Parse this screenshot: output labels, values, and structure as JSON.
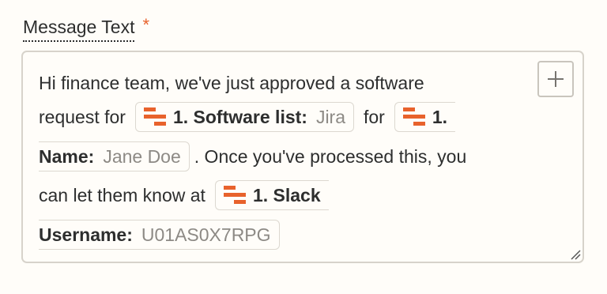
{
  "field": {
    "label": "Message Text",
    "required_mark": "*"
  },
  "message": {
    "line1": "Hi finance team, we've just approved a software",
    "request_for": "request for",
    "software_key": "1. Software list:",
    "software_value": "Jira",
    "for_word": "for",
    "name_key_part1": "1.",
    "name_key_part2": "Name:",
    "name_value": "Jane Doe",
    "after_name": ". Once you've processed this, you",
    "let_them_know": "can let them know at",
    "slack_key_part1": "1. Slack",
    "slack_key_part2": "Username:",
    "slack_value": "U01AS0X7RPG"
  },
  "colors": {
    "accent": "#e8622c",
    "text": "#2d2e2e",
    "muted": "#8d8a85",
    "border": "#d7d3cb"
  },
  "icons": {
    "pill_icon": "zapier-step-icon",
    "insert_icon": "plus-icon",
    "resize_icon": "resize-grip-icon"
  }
}
